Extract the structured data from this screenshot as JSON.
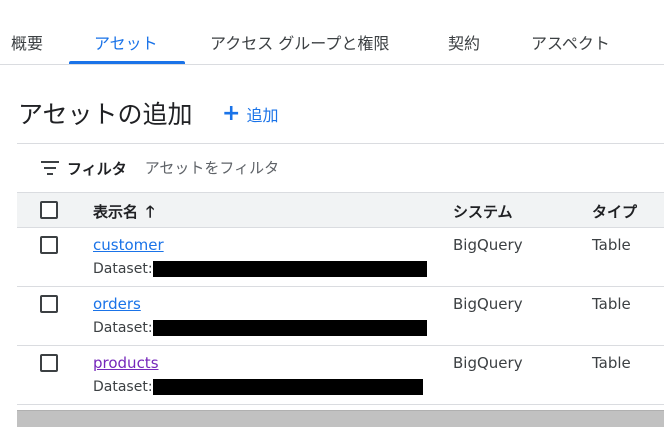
{
  "tabs": [
    {
      "label": "概要",
      "active": false
    },
    {
      "label": "アセット",
      "active": true
    },
    {
      "label": "アクセス グループと権限",
      "active": false
    },
    {
      "label": "契約",
      "active": false
    },
    {
      "label": "アスペクト",
      "active": false
    }
  ],
  "page": {
    "title": "アセットの追加",
    "add_label": "追加",
    "add_icon": "plus-icon"
  },
  "filter": {
    "label": "フィルタ",
    "placeholder": "アセットをフィルタ",
    "icon": "filter-list-icon"
  },
  "table": {
    "columns": {
      "name": "表示名",
      "system": "システム",
      "type": "タイプ"
    },
    "sort": {
      "column": "name",
      "direction": "ascending",
      "icon": "arrow-up-icon"
    },
    "rows": [
      {
        "name": "customer",
        "dataset_label": "Dataset:",
        "system": "BigQuery",
        "type": "Table",
        "link_color": "#1a73e8"
      },
      {
        "name": "orders",
        "dataset_label": "Dataset:",
        "system": "BigQuery",
        "type": "Table",
        "link_color": "#1a73e8"
      },
      {
        "name": "products",
        "dataset_label": "Dataset:",
        "system": "BigQuery",
        "type": "Table",
        "link_color": "#7627bb"
      }
    ]
  },
  "colors": {
    "accent": "#1a73e8",
    "visited_link": "#7627bb",
    "header_bg": "#f1f3f4",
    "divider": "#dadce0"
  }
}
